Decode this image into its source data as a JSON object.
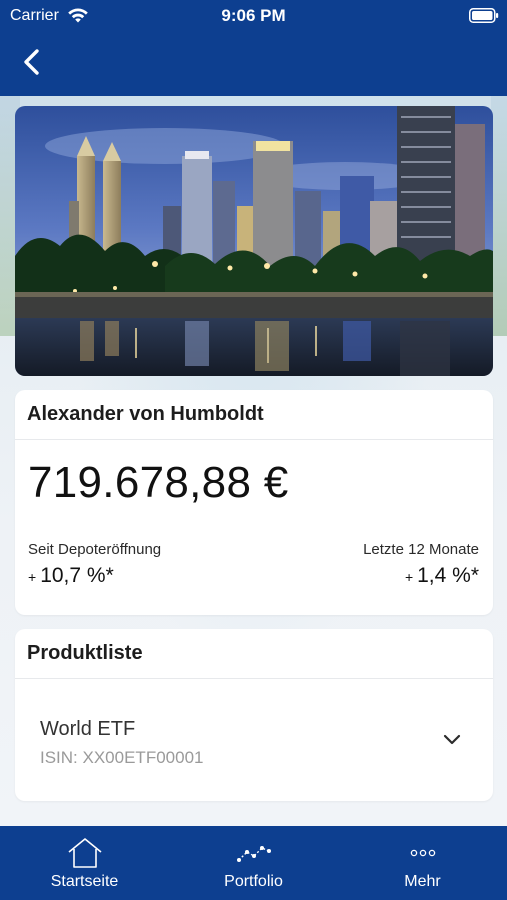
{
  "status_bar": {
    "carrier": "Carrier",
    "time": "9:06 PM"
  },
  "nav": {
    "back_icon": "chevron-left-icon"
  },
  "hero": {
    "image": "city-skyline-night-photo"
  },
  "account": {
    "name": "Alexander von Humboldt",
    "balance": "719.678,88 €",
    "since_opening": {
      "label": "Seit Depoteröffnung",
      "sign": "+",
      "value": "10,7 %*"
    },
    "last_12_months": {
      "label": "Letzte 12 Monate",
      "sign": "+",
      "value": "1,4 %*"
    }
  },
  "product_list": {
    "title": "Produktliste",
    "items": [
      {
        "name": "World ETF",
        "isin": "ISIN: XX00ETF00001",
        "expand_icon": "chevron-down-icon"
      }
    ]
  },
  "tabbar": {
    "items": [
      {
        "label": "Startseite",
        "icon": "house-icon"
      },
      {
        "label": "Portfolio",
        "icon": "chart-line-icon"
      },
      {
        "label": "Mehr",
        "icon": "more-dots-icon"
      }
    ]
  },
  "colors": {
    "brand_blue": "#0d3f90",
    "background": "#eef2f6",
    "card": "#ffffff"
  }
}
